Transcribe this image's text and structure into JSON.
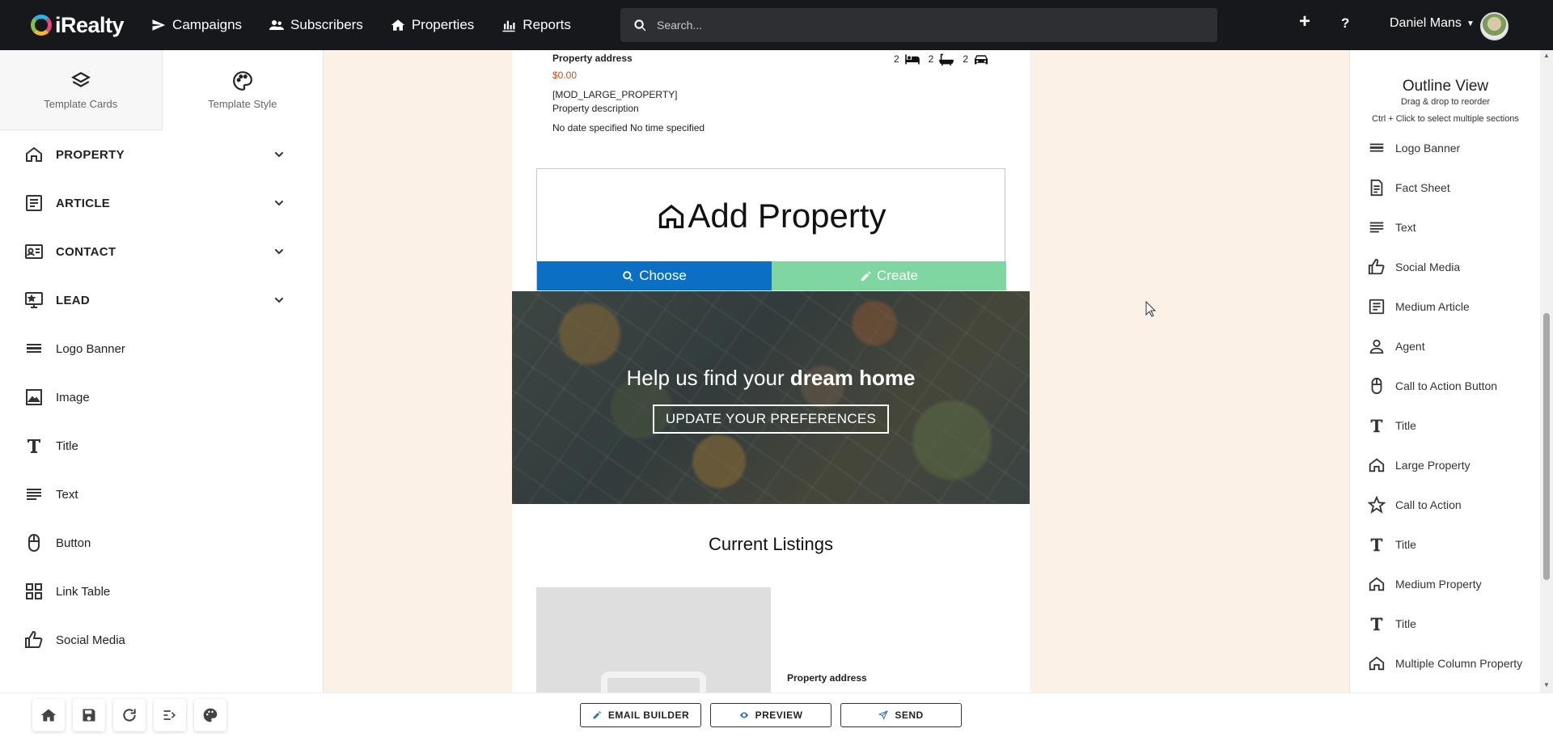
{
  "brand": {
    "name": "iRealty"
  },
  "nav": {
    "items": [
      {
        "label": "Campaigns",
        "icon": "paper-plane-icon"
      },
      {
        "label": "Subscribers",
        "icon": "users-icon"
      },
      {
        "label": "Properties",
        "icon": "home-icon"
      },
      {
        "label": "Reports",
        "icon": "bar-chart-icon"
      }
    ],
    "search_placeholder": "Search...",
    "plus_label": "+",
    "help_label": "?",
    "user_name": "Daniel Mans"
  },
  "left_panel": {
    "tabs": [
      {
        "label": "Template Cards",
        "icon": "layers-icon"
      },
      {
        "label": "Template Style",
        "icon": "palette-icon"
      }
    ],
    "categories": [
      {
        "label": "PROPERTY",
        "icon": "home-outline-icon"
      },
      {
        "label": "ARTICLE",
        "icon": "article-icon"
      },
      {
        "label": "CONTACT",
        "icon": "contact-card-icon"
      },
      {
        "label": "LEAD",
        "icon": "lead-monitor-icon"
      }
    ],
    "items": [
      {
        "label": "Logo Banner",
        "icon": "logo-banner-icon"
      },
      {
        "label": "Image",
        "icon": "image-icon"
      },
      {
        "label": "Title",
        "icon": "title-t-icon"
      },
      {
        "label": "Text",
        "icon": "text-lines-icon"
      },
      {
        "label": "Button",
        "icon": "mouse-icon"
      },
      {
        "label": "Link Table",
        "icon": "grid-icon"
      },
      {
        "label": "Social Media",
        "icon": "thumbs-up-icon"
      }
    ]
  },
  "email": {
    "top_property": {
      "address": "Property address",
      "price": "$0.00",
      "mod": "[MOD_LARGE_PROPERTY]",
      "description": "Property description",
      "date": "No date specified No time specified",
      "beds": "2",
      "baths": "2",
      "cars": "2"
    },
    "add_property": {
      "title": "Add Property",
      "choose_label": "Choose",
      "create_label": "Create"
    },
    "hero": {
      "title_normal": "Help us find your",
      "title_bold": "dream home",
      "button_label": "UPDATE YOUR PREFERENCES"
    },
    "listings": {
      "title": "Current Listings",
      "address": "Property address"
    }
  },
  "outline": {
    "title": "Outline View",
    "subtitle": "Drag & drop to reorder",
    "hint": "Ctrl + Click to select multiple sections",
    "items": [
      {
        "label": "Logo Banner",
        "icon": "logo-banner-icon"
      },
      {
        "label": "Fact Sheet",
        "icon": "fact-sheet-icon"
      },
      {
        "label": "Text",
        "icon": "text-lines-icon"
      },
      {
        "label": "Social Media",
        "icon": "thumbs-up-icon"
      },
      {
        "label": "Medium Article",
        "icon": "article-icon"
      },
      {
        "label": "Agent",
        "icon": "person-icon"
      },
      {
        "label": "Call to Action Button",
        "icon": "mouse-icon"
      },
      {
        "label": "Title",
        "icon": "title-t-icon"
      },
      {
        "label": "Large Property",
        "icon": "home-outline-icon"
      },
      {
        "label": "Call to Action",
        "icon": "star-icon"
      },
      {
        "label": "Title",
        "icon": "title-t-icon"
      },
      {
        "label": "Medium Property",
        "icon": "home-outline-icon"
      },
      {
        "label": "Title",
        "icon": "title-t-icon"
      },
      {
        "label": "Multiple Column Property",
        "icon": "home-outline-icon"
      }
    ]
  },
  "bottom_bar": {
    "tools": [
      "home-icon",
      "save-icon",
      "redo-icon",
      "outline-toggle-icon",
      "palette-icon"
    ],
    "email_builder_label": "EMAIL BUILDER",
    "preview_label": "PREVIEW",
    "send_label": "SEND"
  },
  "colors": {
    "nav_bg": "#17181c",
    "canvas_bg": "#fbf1e6",
    "choose_blue": "#0b6fc4",
    "create_green": "#7fd6a0",
    "price_orange": "#c0521a"
  }
}
